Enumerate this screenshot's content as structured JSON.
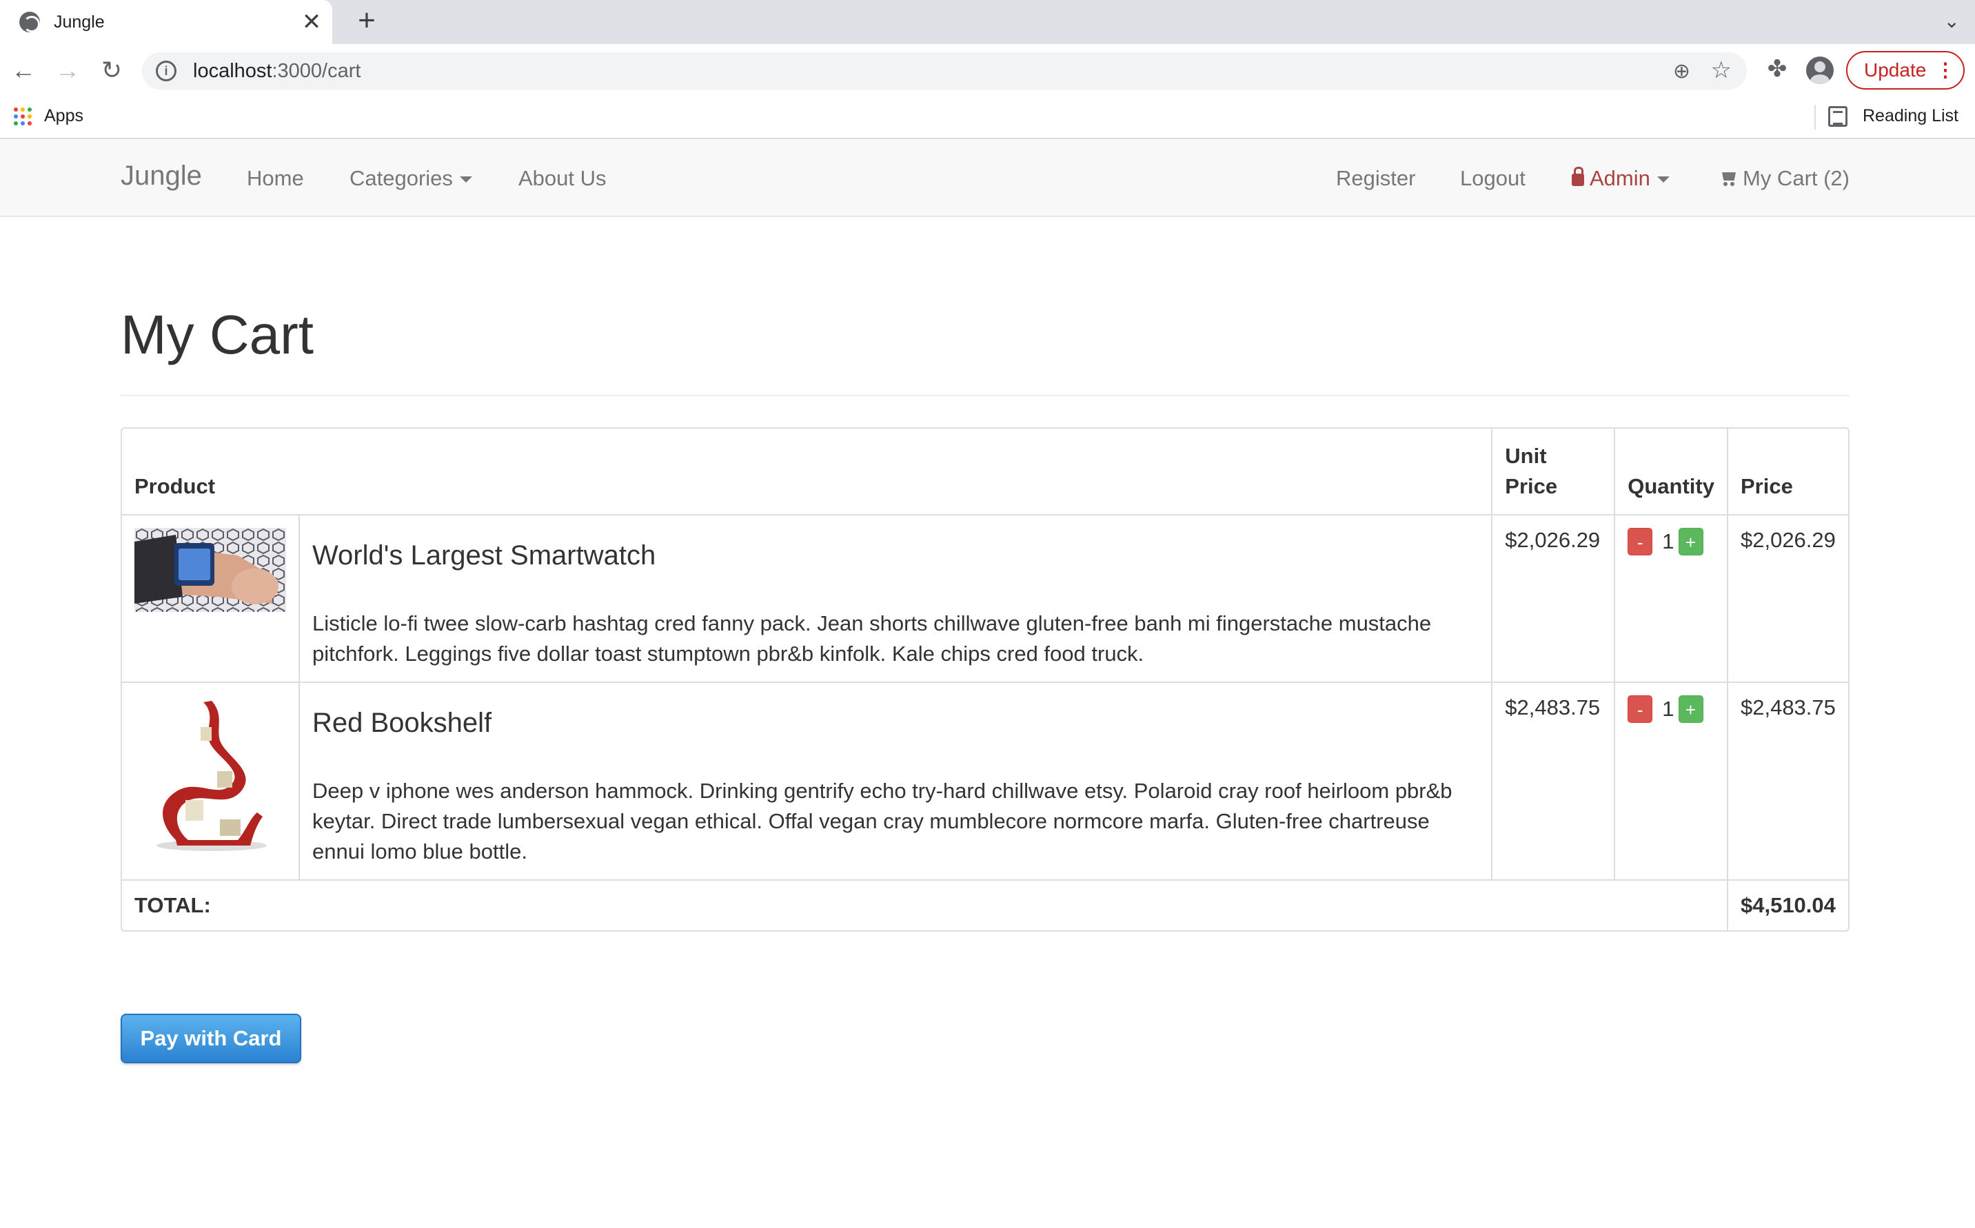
{
  "browser": {
    "tab_title": "Jungle",
    "tab_close": "✕",
    "new_tab": "+",
    "tab_list": "⌄",
    "back": "←",
    "forward": "→",
    "reload": "↻",
    "url_host": "localhost",
    "url_path": ":3000/cart",
    "update_label": "Update",
    "update_menu": "⋮",
    "apps_label": "Apps",
    "reading_list_label": "Reading List",
    "apps_colors": [
      "#ea4335",
      "#fbbc04",
      "#34a853",
      "#4285f4",
      "#ea4335",
      "#fbbc04",
      "#34a853",
      "#4285f4",
      "#ea4335"
    ]
  },
  "nav": {
    "brand": "Jungle",
    "home": "Home",
    "categories": "Categories",
    "about": "About Us",
    "register": "Register",
    "logout": "Logout",
    "admin": "Admin",
    "my_cart": "My Cart (2)"
  },
  "page": {
    "title": "My Cart",
    "pay_button": "Pay with Card"
  },
  "table": {
    "headers": {
      "product": "Product",
      "unit_price_1": "Unit",
      "unit_price_2": "Price",
      "quantity": "Quantity",
      "price": "Price"
    },
    "items": [
      {
        "name": "World's Largest Smartwatch",
        "description": "Listicle lo-fi twee slow-carb hashtag cred fanny pack. Jean shorts chillwave gluten-free banh mi fingerstache mustache pitchfork. Leggings five dollar toast stumptown pbr&b kinfolk. Kale chips cred food truck.",
        "unit_price": "$2,026.29",
        "quantity": "1",
        "price": "$2,026.29",
        "minus": "-",
        "plus": "+"
      },
      {
        "name": "Red Bookshelf",
        "description": "Deep v iphone wes anderson hammock. Drinking gentrify echo try-hard chillwave etsy. Polaroid cray roof heirloom pbr&b keytar. Direct trade lumbersexual vegan ethical. Offal vegan cray mumblecore normcore marfa. Gluten-free chartreuse ennui lomo blue bottle.",
        "unit_price": "$2,483.75",
        "quantity": "1",
        "price": "$2,483.75",
        "minus": "-",
        "plus": "+"
      }
    ],
    "total_label": "TOTAL:",
    "total_value": "$4,510.04"
  },
  "colors": {
    "danger": "#d9534f",
    "success": "#5cb85c",
    "primary": "#2b82d1",
    "admin": "#a94442"
  }
}
